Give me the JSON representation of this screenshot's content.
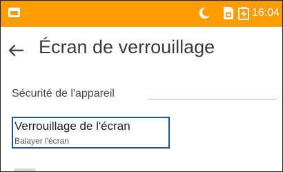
{
  "status_bar": {
    "time": "16:04",
    "background": "#ff9c00",
    "icons": [
      "app-notification-icon",
      "moon-icon",
      "sim-icon",
      "battery-charging-icon"
    ]
  },
  "app_bar": {
    "title": "Écran de verrouillage",
    "back_icon": "back-arrow-icon"
  },
  "section": {
    "header": "Sécurité de l'appareil"
  },
  "screen_lock": {
    "title": "Verrouillage de l'écran",
    "summary": "Balayer l'écran",
    "highlight_color": "#1f4ea3"
  }
}
